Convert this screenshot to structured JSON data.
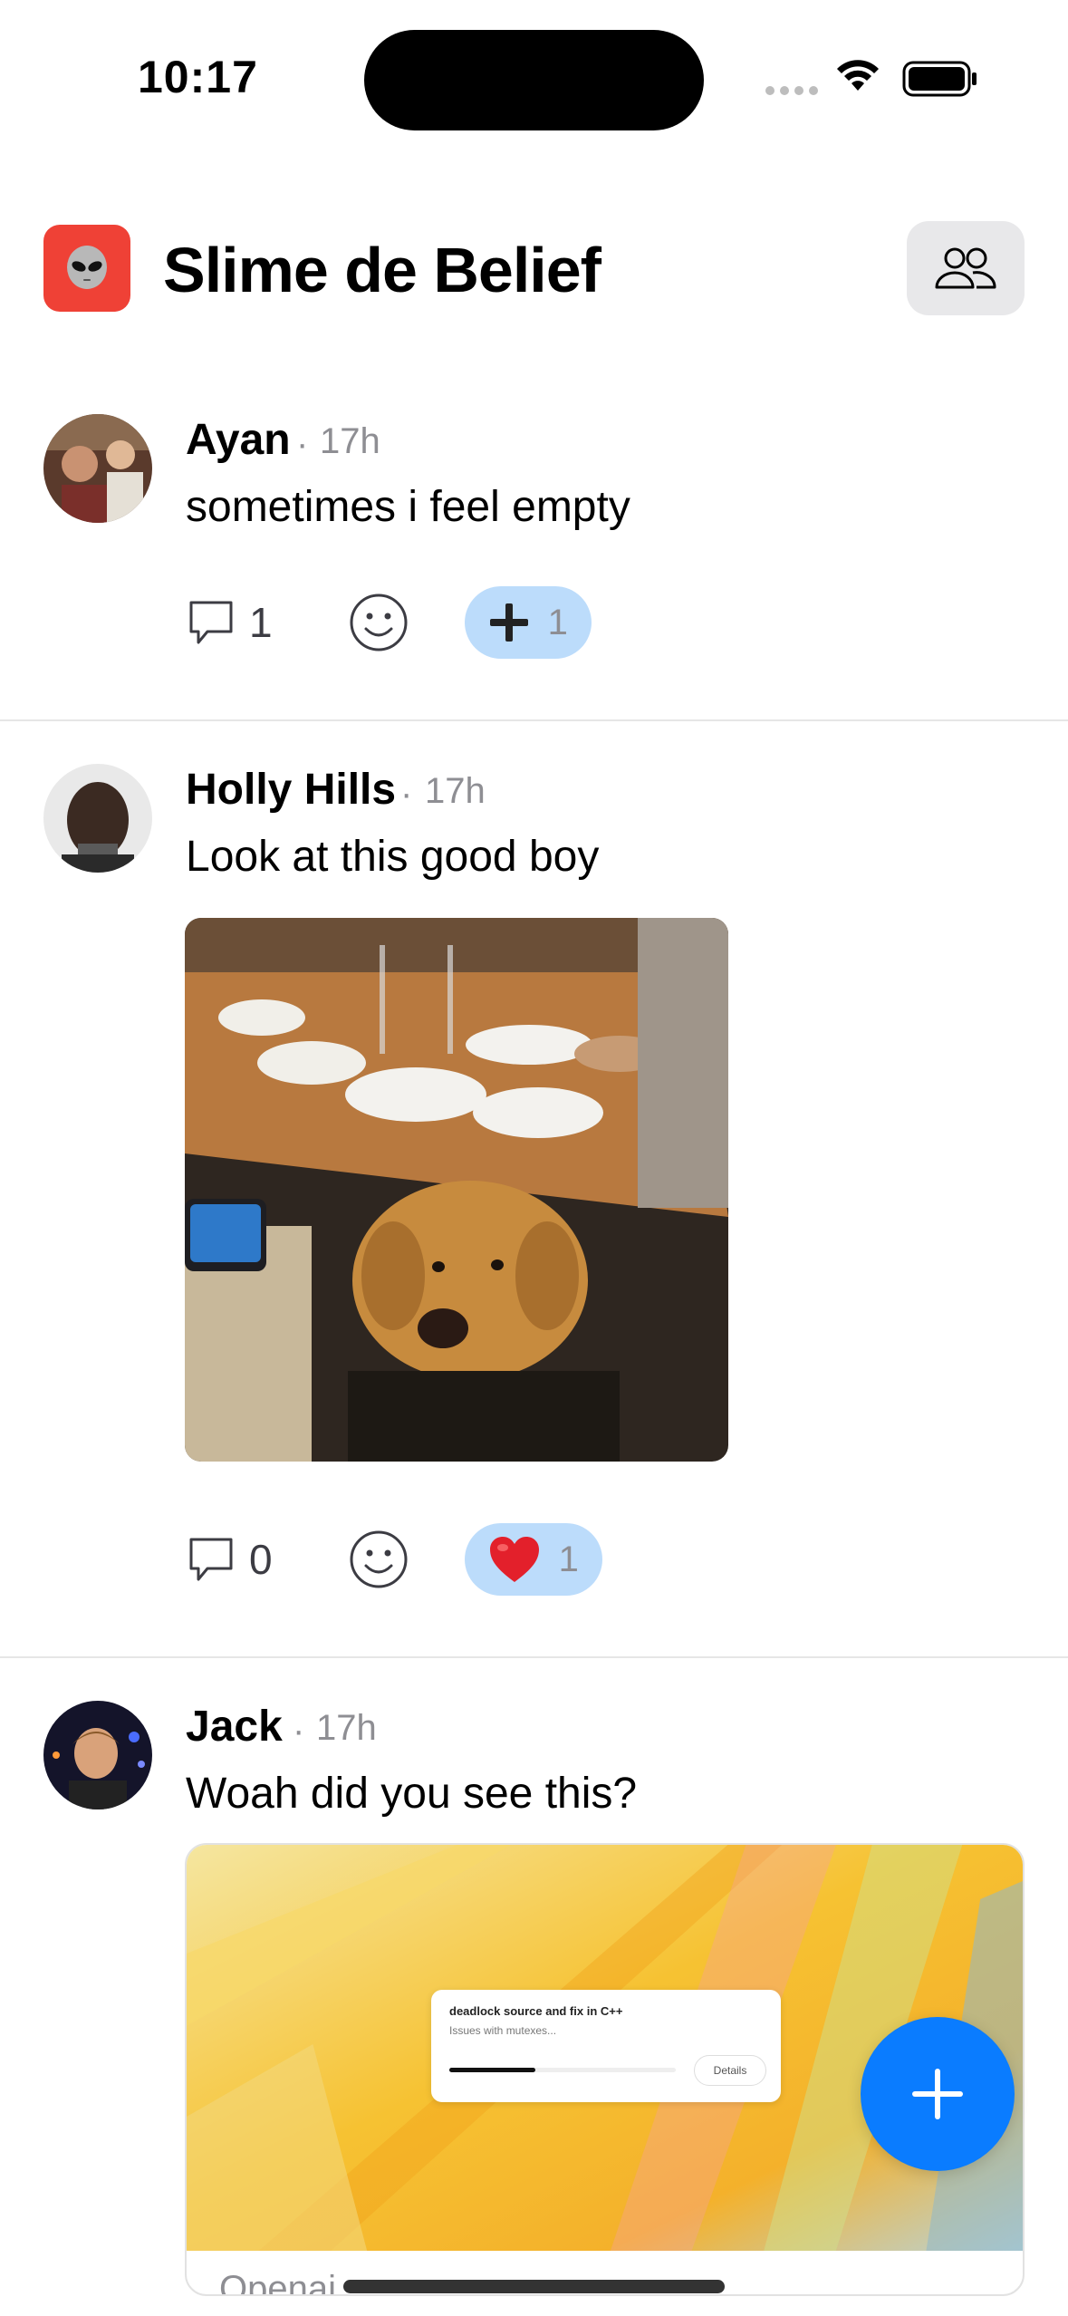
{
  "status_bar": {
    "time": "10:17"
  },
  "header": {
    "title": "Slime de Belief",
    "app_icon": "alien-icon",
    "members_icon": "people-icon"
  },
  "posts": [
    {
      "author": "Ayan",
      "time": "17h",
      "text": "sometimes i feel empty",
      "comment_count": "1",
      "reaction_emoji": "➕",
      "reaction_count": "1"
    },
    {
      "author": "Holly Hills",
      "time": "17h",
      "text": "Look at this good boy",
      "comment_count": "0",
      "reaction_emoji": "❤️",
      "reaction_count": "1"
    },
    {
      "author": "Jack",
      "time": "17h",
      "text": "Woah did you see this?",
      "link": {
        "card_title": "deadlock source and fix in C++",
        "card_subtitle": "Issues with mutexes...",
        "card_button": "Details",
        "card_progress": 0.38,
        "source": "Openai"
      }
    }
  ],
  "separator": "·",
  "fab": {
    "icon": "plus-icon"
  },
  "colors": {
    "accent": "#0a7cff",
    "app_icon_bg": "#ef4136",
    "reaction_pill": "#bcdcfb"
  }
}
